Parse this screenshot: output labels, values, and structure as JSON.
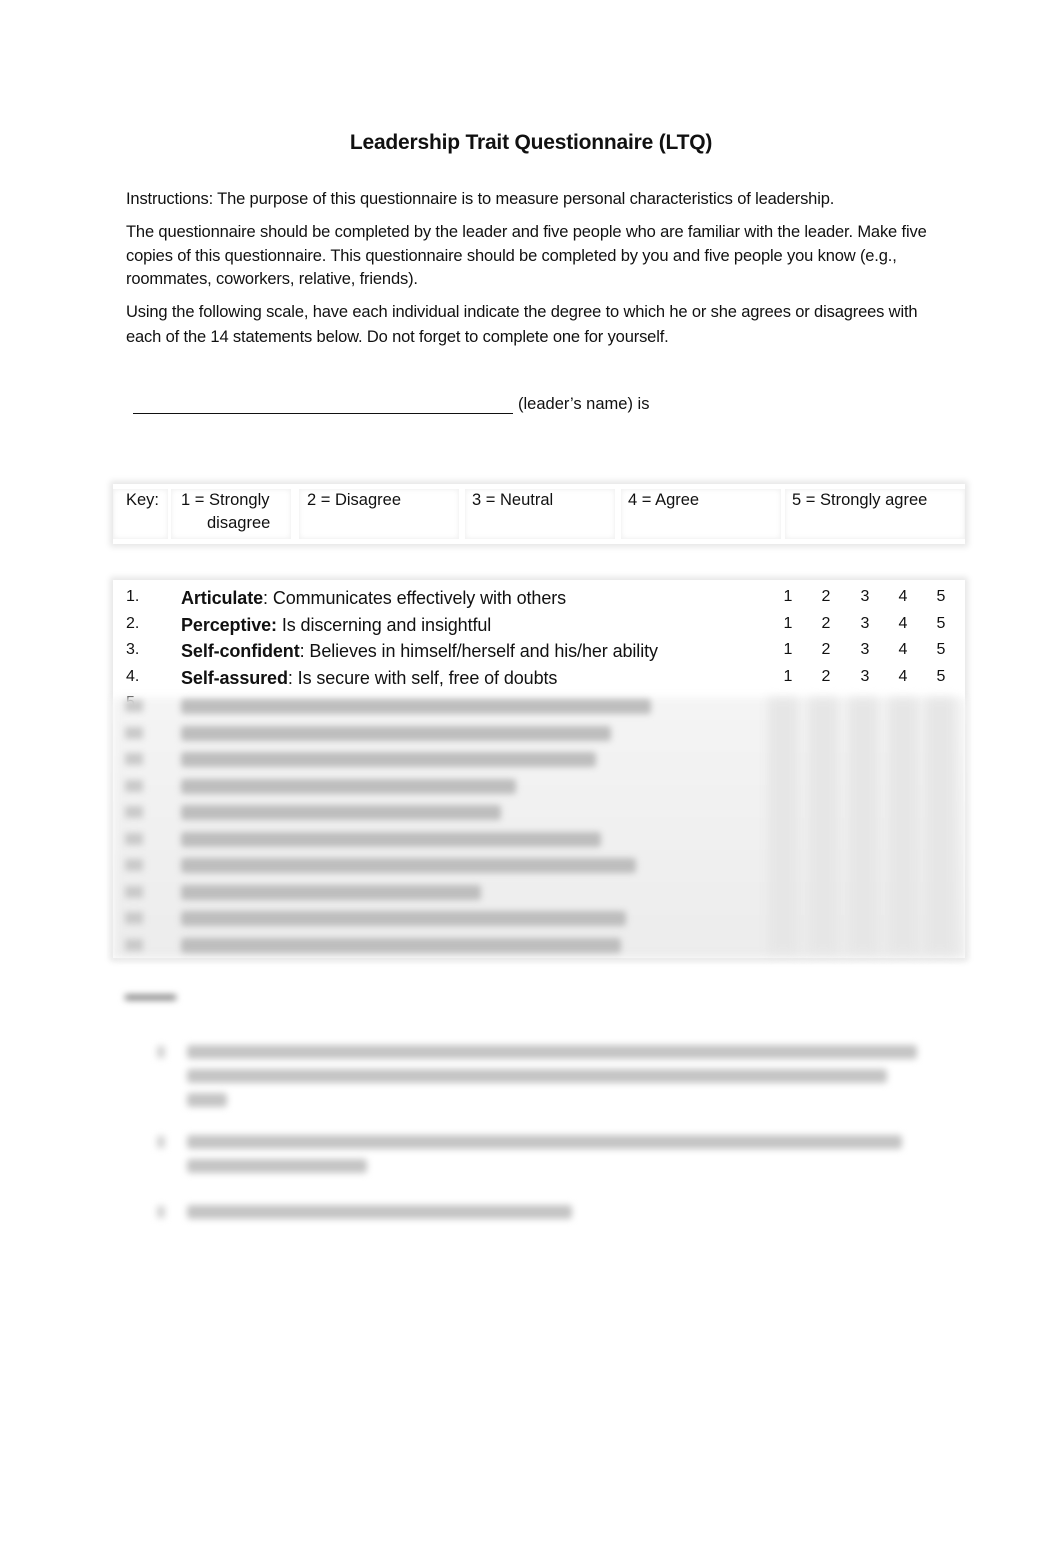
{
  "document": {
    "title": "Leadership Trait Questionnaire (LTQ)",
    "paragraphs": [
      "Instructions: The purpose of this questionnaire is to measure personal characteristics of leadership.",
      "The questionnaire should be completed by the leader and five people who are familiar with the leader. Make five copies of this questionnaire. This questionnaire should be completed by you and five people you know (e.g., roommates, coworkers, relative, friends).",
      "Using the following scale, have each individual indicate the degree to which he or she agrees or disagrees with each of the 14 statements below.  Do not forget to complete one for yourself."
    ],
    "leader_line_suffix": "(leader’s name) is"
  },
  "key": {
    "label": "Key:",
    "scale": [
      {
        "line1": "1 = Strongly",
        "line2": "disagree"
      },
      {
        "line1": "2 = Disagree"
      },
      {
        "line1": "3 = Neutral"
      },
      {
        "line1": "4 = Agree"
      },
      {
        "line1": "5 = Strongly agree"
      }
    ]
  },
  "items": [
    {
      "num": "1.",
      "trait": "Articulate",
      "sep": ":  ",
      "desc": "Communicates effectively with others",
      "options": [
        "1",
        "2",
        "3",
        "4",
        "5"
      ]
    },
    {
      "num": "2.",
      "trait": "Perceptive:",
      "sep": " ",
      "desc": "Is discerning and insightful",
      "options": [
        "1",
        "2",
        "3",
        "4",
        "5"
      ]
    },
    {
      "num": "3.",
      "trait": "Self-confident",
      "sep": ": ",
      "desc": "Believes in himself/herself and his/her ability",
      "options": [
        "1",
        "2",
        "3",
        "4",
        "5"
      ]
    },
    {
      "num": "4.",
      "trait": "Self-assured",
      "sep": ": ",
      "desc": "Is secure with self, free of doubts",
      "options": [
        "1",
        "2",
        "3",
        "4",
        "5"
      ]
    },
    {
      "num": "5."
    }
  ]
}
